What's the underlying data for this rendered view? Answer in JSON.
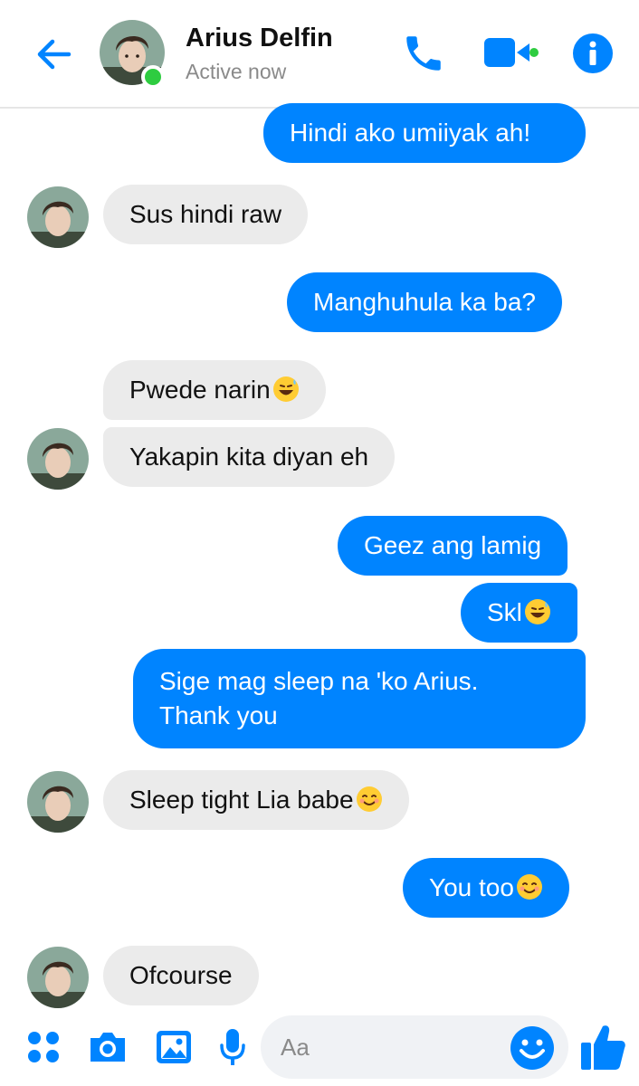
{
  "header": {
    "contact_name": "Arius Delfin",
    "status": "Active now",
    "accent_color": "#0084ff",
    "active_color": "#2ecc40",
    "icons": [
      "back-arrow-icon",
      "phone-icon",
      "video-camera-icon",
      "info-icon"
    ]
  },
  "messages": [
    {
      "side": "outgoing",
      "text": "Hindi ako umiiyak ah!"
    },
    {
      "side": "incoming",
      "text": "Sus hindi raw"
    },
    {
      "side": "outgoing",
      "text": "Manghuhula ka ba?"
    },
    {
      "side": "incoming",
      "text": "Pwede narin",
      "emoji": "grinning-sweat"
    },
    {
      "side": "incoming",
      "text": "Yakapin kita diyan eh"
    },
    {
      "side": "outgoing",
      "text": "Geez ang lamig"
    },
    {
      "side": "outgoing",
      "text": "Skl",
      "emoji": "grinning-sweat"
    },
    {
      "side": "outgoing",
      "text_line1": "Sige mag sleep na 'ko Arius.",
      "text_line2": "Thank you"
    },
    {
      "side": "incoming",
      "text": "Sleep tight Lia babe",
      "emoji": "smiling-face"
    },
    {
      "side": "outgoing",
      "text": "You too",
      "emoji": "smiling-face"
    },
    {
      "side": "incoming",
      "text": "Ofcourse"
    }
  ],
  "composer": {
    "placeholder": "Aa",
    "icons": [
      "more-apps-icon",
      "camera-icon",
      "gallery-icon",
      "microphone-icon",
      "emoji-icon",
      "thumbs-up-icon"
    ]
  }
}
